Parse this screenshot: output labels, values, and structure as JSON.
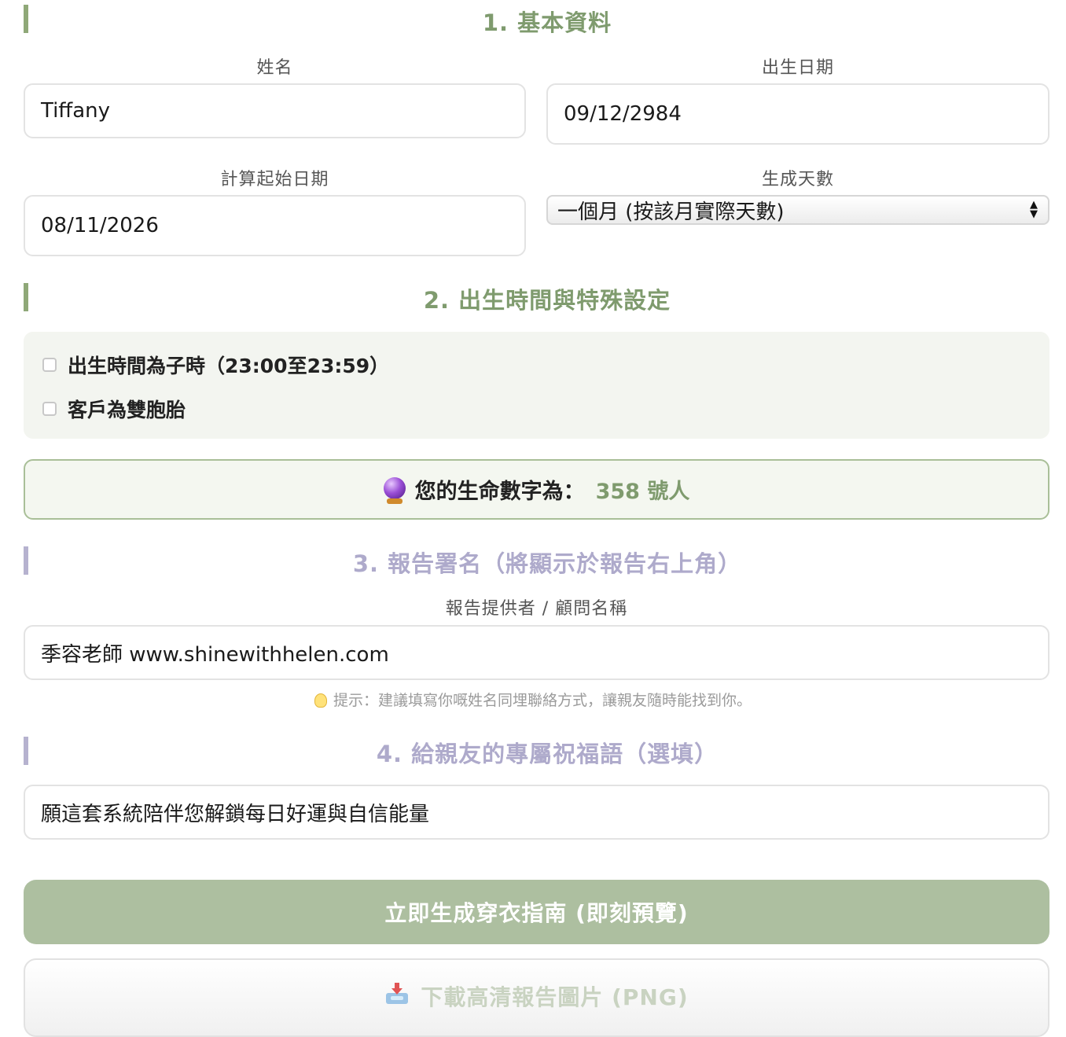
{
  "section1": {
    "title": "1. 基本資料"
  },
  "fields": {
    "name": {
      "label": "姓名",
      "value": "Tiffany"
    },
    "birthdate": {
      "label": "出生日期",
      "value": "09/12/2984"
    },
    "start_date": {
      "label": "計算起始日期",
      "value": "08/11/2026"
    },
    "days": {
      "label": "生成天數",
      "selected": "一個月 (按該月實際天數)"
    }
  },
  "section2": {
    "title": "2. 出生時間與特殊設定",
    "options": [
      {
        "label": "出生時間為子時（23:00至23:59）",
        "checked": false
      },
      {
        "label": "客戶為雙胞胎",
        "checked": false
      }
    ]
  },
  "life_number": {
    "prefix": "您的生命數字為：",
    "value": "358 號人",
    "icon": "crystal-ball-icon"
  },
  "section3": {
    "title": "3. 報告署名（將顯示於報告右上角）",
    "provider_label": "報告提供者 / 顧問名稱",
    "provider_value": "季容老師 www.shinewithhelen.com",
    "hint": "提示：建議填寫你嘅姓名同埋聯絡方式，讓親友隨時能找到你。"
  },
  "section4": {
    "title": "4. 給親友的專屬祝福語（選填）",
    "blessing_value": "願這套系統陪伴您解鎖每日好運與自信能量"
  },
  "buttons": {
    "generate": "立即生成穿衣指南 (即刻預覽)",
    "download": "下載高清報告圖片 (PNG)"
  },
  "colors": {
    "accent_green": "#7f9b6e",
    "accent_purple": "#aeaacb",
    "button_green": "#adbfa0"
  }
}
